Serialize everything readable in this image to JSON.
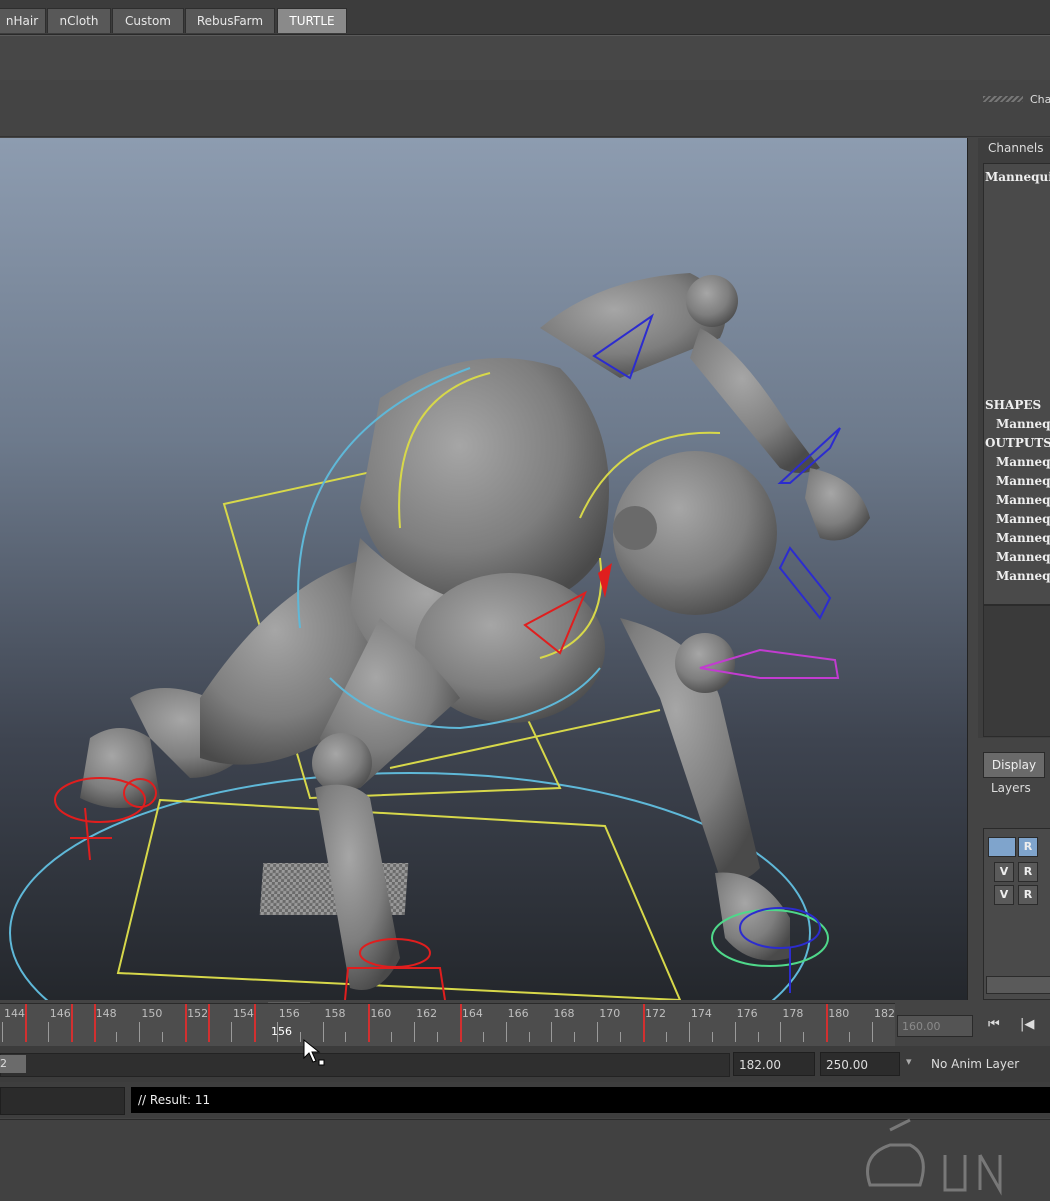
{
  "shelf": {
    "tabs": [
      "nHair",
      "nCloth",
      "Custom",
      "RebusFarm",
      "TURTLE"
    ],
    "active_tab": "TURTLE"
  },
  "panel": {
    "channel_toggle": "Cha"
  },
  "channel_box": {
    "title": "Channels",
    "object_name": "Mannequi",
    "shapes_header": "SHAPES",
    "shapes": [
      "Manneq"
    ],
    "outputs_header": "OUTPUTS",
    "outputs": [
      "Manneq",
      "Manneq",
      "Manneq",
      "Manneq",
      "Manneq",
      "Manneq",
      "Manneq"
    ]
  },
  "layer_editor": {
    "tab": "Display",
    "menu": "Layers",
    "rows": [
      {
        "v": "",
        "r": "R"
      },
      {
        "v": "V",
        "r": "R"
      },
      {
        "v": "V",
        "r": "R"
      }
    ]
  },
  "timeline": {
    "tick_labels": [
      "144",
      "146",
      "148",
      "150",
      "152",
      "154",
      "156",
      "158",
      "160",
      "162",
      "164",
      "166",
      "168",
      "170",
      "172",
      "174",
      "176",
      "178",
      "180",
      "182"
    ],
    "key_frames": [
      145,
      147,
      148,
      152,
      153,
      155,
      160,
      164,
      172,
      180
    ],
    "current_frame": "156",
    "current_time_field": "160.00",
    "playback_buttons": [
      "⏮",
      "|◀"
    ]
  },
  "range": {
    "start_handle": "2",
    "end_time": "182.00",
    "end_range": "250.00",
    "anim_layer": "No Anim Layer"
  },
  "command_line": {
    "result": "// Result: 11"
  },
  "colors": {
    "viewport_top": "#8d9cb0",
    "viewport_bottom": "#24272c",
    "key_tick": "#d23030",
    "ctrl_yellow": "#d7d84a",
    "ctrl_cyan": "#5fb8d8",
    "ctrl_blue": "#2c2ccf",
    "ctrl_red": "#e01e1e",
    "ctrl_magenta": "#c23cd0",
    "mannequin": "#8a8a8a"
  }
}
